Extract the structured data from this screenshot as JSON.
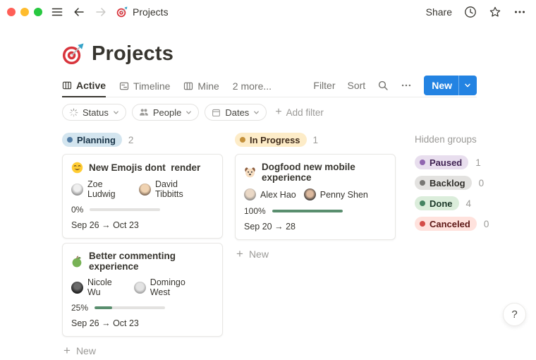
{
  "titlebar": {
    "doc_emoji": "🎯",
    "doc_title": "Projects",
    "share_label": "Share"
  },
  "header": {
    "emoji": "🎯",
    "title": "Projects"
  },
  "tabs": {
    "items": [
      {
        "label": "Active",
        "active": true
      },
      {
        "label": "Timeline",
        "active": false
      },
      {
        "label": "Mine",
        "active": false
      },
      {
        "label": "2 more...",
        "active": false
      }
    ]
  },
  "view_controls": {
    "filter_label": "Filter",
    "sort_label": "Sort",
    "new_label": "New"
  },
  "filter_bar": {
    "chips": [
      {
        "label": "Status"
      },
      {
        "label": "People"
      },
      {
        "label": "Dates"
      }
    ],
    "add_filter_label": "Add filter"
  },
  "board": {
    "columns": [
      {
        "name": "Planning",
        "count": "2",
        "colors": {
          "bg": "#D3E5EF",
          "dot": "#527DA5",
          "text": "#183347"
        },
        "cards": [
          {
            "emoji": "😂",
            "title": "New Emojis dont  render",
            "people": [
              "Zoe Ludwig",
              "David Tibbitts"
            ],
            "progress_label": "0%",
            "dates": "Sep 26 → Oct 23"
          },
          {
            "emoji": "🍏",
            "title": "Better commenting experience",
            "people": [
              "Nicole Wu",
              "Domingo West"
            ],
            "progress_label": "25%",
            "dates": "Sep 26 → Oct 23"
          }
        ],
        "new_label": "New"
      },
      {
        "name": "In Progress",
        "count": "1",
        "colors": {
          "bg": "#FDECC8",
          "dot": "#C4913B",
          "text": "#402C1B"
        },
        "cards": [
          {
            "emoji": "🐶",
            "title": "Dogfood new mobile experience",
            "people": [
              "Alex Hao",
              "Penny Shen"
            ],
            "progress_label": "100%",
            "dates": "Sep 20 → 28"
          }
        ],
        "new_label": "New"
      }
    ],
    "hidden_groups": {
      "title": "Hidden groups",
      "groups": [
        {
          "name": "Paused",
          "count": "1",
          "bg": "#E8DEEE",
          "dot": "#9065B0",
          "text": "#412454"
        },
        {
          "name": "Backlog",
          "count": "0",
          "bg": "#E3E2E0",
          "dot": "#787774",
          "text": "#32302C"
        },
        {
          "name": "Done",
          "count": "4",
          "bg": "#DBEDDB",
          "dot": "#448361",
          "text": "#1C3829"
        },
        {
          "name": "Canceled",
          "count": "0",
          "bg": "#FFE2DD",
          "dot": "#D44C47",
          "text": "#5D1715"
        }
      ]
    }
  },
  "colors": {
    "accent_blue": "#2383E2",
    "progress_green": "#598E6E"
  },
  "help": {
    "label": "?"
  }
}
